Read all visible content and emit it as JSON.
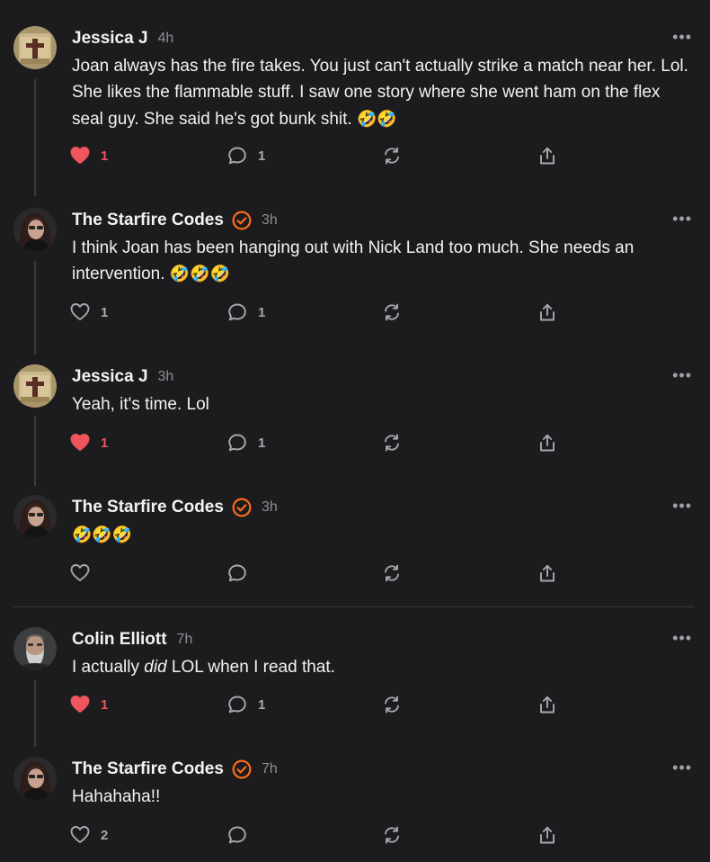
{
  "comments": [
    {
      "name": "Jessica J",
      "time": "4h",
      "verified": false,
      "text": "Joan always has the fire takes. You just can't actually strike a match near her. Lol. She likes the flammable stuff. I saw one story where she went ham on the flex seal guy. She said he's got bunk shit.",
      "emoji": "🤣🤣",
      "likes": "1",
      "liked": true,
      "replies": "1",
      "avatar": "cross-avatar"
    },
    {
      "name": "The Starfire Codes",
      "time": "3h",
      "verified": true,
      "text": "I think Joan has been hanging out with Nick Land too much. She needs an intervention.",
      "emoji": "🤣🤣🤣",
      "likes": "1",
      "liked": false,
      "replies": "1",
      "avatar": "woman-avatar"
    },
    {
      "name": "Jessica J",
      "time": "3h",
      "verified": false,
      "text": "Yeah, it's time. Lol",
      "emoji": "",
      "likes": "1",
      "liked": true,
      "replies": "1",
      "avatar": "cross-avatar"
    },
    {
      "name": "The Starfire Codes",
      "time": "3h",
      "verified": true,
      "text": "",
      "emoji": "🤣🤣🤣",
      "likes": "",
      "liked": false,
      "replies": "",
      "avatar": "woman-avatar"
    },
    {
      "name": "Colin Elliott",
      "time": "7h",
      "verified": false,
      "text_before": "I actually ",
      "text_em": "did",
      "text_after": " LOL when I read that.",
      "likes": "1",
      "liked": true,
      "replies": "1",
      "avatar": "man-avatar"
    },
    {
      "name": "The Starfire Codes",
      "time": "7h",
      "verified": true,
      "text": "Hahahaha!!",
      "emoji": "",
      "likes": "2",
      "liked": false,
      "replies": "",
      "avatar": "woman-avatar"
    }
  ],
  "more_label": "•••",
  "colors": {
    "background": "#1c1c1e",
    "liked": "#f0545c",
    "verified": "#ff6b1a",
    "muted": "#8e8e93"
  },
  "icons": [
    "heart-icon",
    "comment-icon",
    "restack-icon",
    "share-icon",
    "more-icon",
    "verified-badge-icon"
  ]
}
